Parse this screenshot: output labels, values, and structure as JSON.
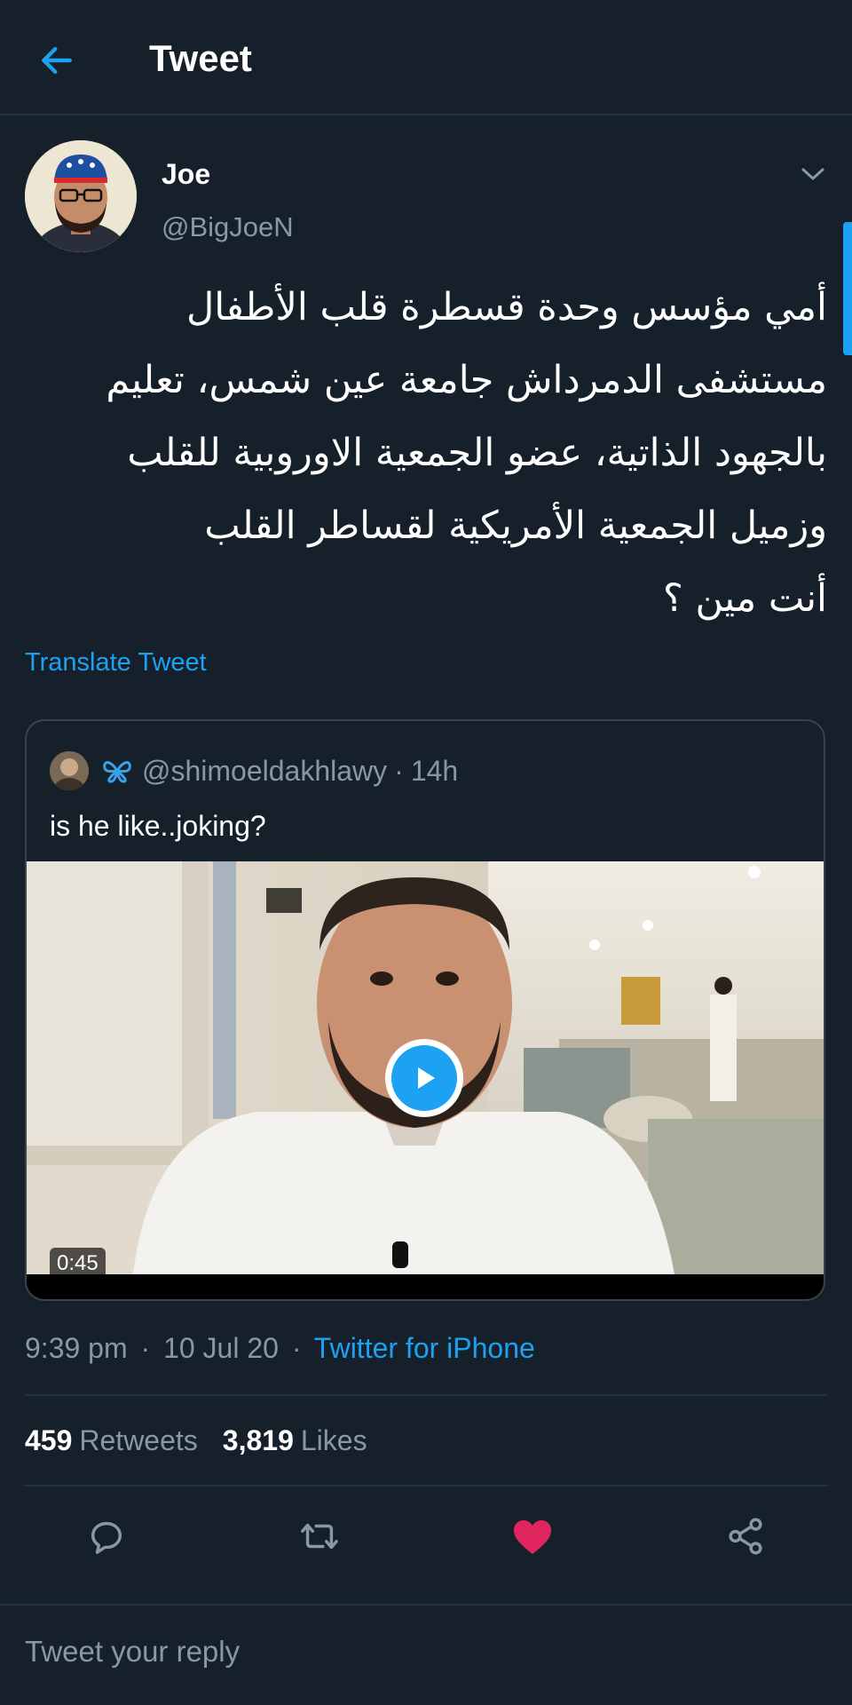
{
  "header": {
    "title": "Tweet",
    "back_icon": "arrow-left-icon"
  },
  "tweet": {
    "author": {
      "display_name": "Joe",
      "handle": "@BigJoeN"
    },
    "menu_icon": "chevron-down-icon",
    "body_lines": [
      "أمي مؤسس وحدة قسطرة قلب الأطفال",
      "مستشفى الدمرداش جامعة عين شمس، تعليم",
      "بالجهود الذاتية، عضو الجمعية الاوروبية للقلب",
      "وزميل الجمعية الأمريكية لقساطر القلب",
      "أنت مين ؟"
    ],
    "translate_label": "Translate Tweet",
    "time": "9:39 pm",
    "date": "10 Jul 20",
    "source": "Twitter for iPhone",
    "separator": "·",
    "retweets_count": "459",
    "retweets_label": "Retweets",
    "likes_count": "3,819",
    "likes_label": "Likes"
  },
  "quoted": {
    "badge_icon": "butterfly-icon",
    "handle": "@shimoeldakhlawy",
    "time": "14h",
    "separator": "·",
    "text": "is he like..joking?",
    "video": {
      "duration": "0:45",
      "play_icon": "play-icon"
    }
  },
  "actions": {
    "reply_icon": "reply-icon",
    "retweet_icon": "retweet-icon",
    "like_icon": "heart-icon",
    "like_color": "#e0245e",
    "share_icon": "share-icon"
  },
  "reply": {
    "placeholder": "Tweet your reply"
  },
  "colors": {
    "background": "#15202b",
    "accent": "#1da1f2",
    "secondary_text": "#8899a6",
    "border": "#253341"
  }
}
